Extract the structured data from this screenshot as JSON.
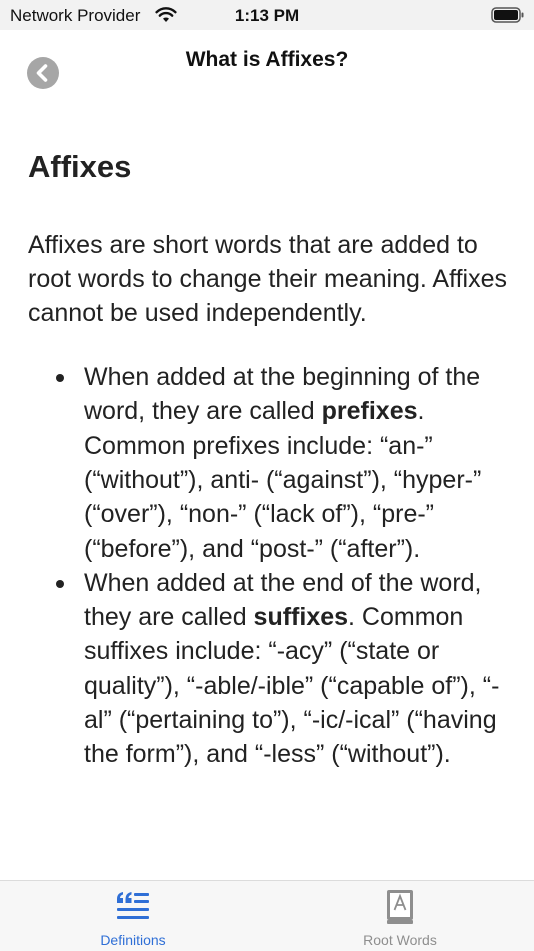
{
  "status_bar": {
    "carrier": "Network Provider",
    "time": "1:13 PM"
  },
  "header": {
    "title": "What is Affixes?",
    "back_icon": "chevron-left-icon"
  },
  "content": {
    "heading": "Affixes",
    "intro": "Affixes are short words that are added to root words to change their meaning. Affixes cannot be used independently.",
    "bullets": [
      {
        "before": "When added at the beginning of the word, they are called ",
        "bold": "prefixes",
        "after": ". Common prefixes include: “an-” (“without”), anti- (“against”), “hyper-” (“over”), “non-” (“lack of”), “pre-” (“before”), and “post-” (“after”)."
      },
      {
        "before": "When added at the end of the word, they are called ",
        "bold": "suffixes",
        "after": ". Common suffixes include: “-acy” (“state or quality”), “-able/-ible” (“capable of”), “-al” (“pertaining to”), “-ic/-ical” (“having the form”), and “-less” (“without”)."
      }
    ]
  },
  "tab_bar": {
    "tabs": [
      {
        "label": "Definitions",
        "icon": "quote-list-icon",
        "active": true
      },
      {
        "label": "Root Words",
        "icon": "book-icon",
        "active": false
      }
    ],
    "active_color": "#2f6fd6",
    "inactive_color": "#8e8e8e"
  }
}
